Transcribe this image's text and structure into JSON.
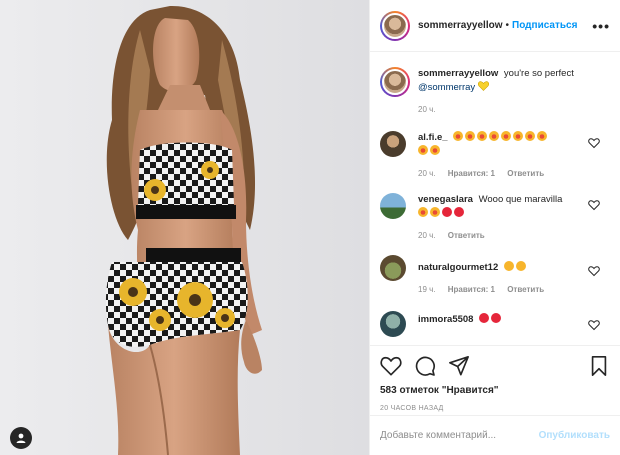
{
  "post": {
    "author": "sommerrayyellow",
    "separator": "•",
    "follow_label": "Подписаться",
    "more_label": "•••"
  },
  "caption": {
    "username": "sommerrayyellow",
    "text": "you're so perfect",
    "mention": "@sommerray",
    "emoji": "yellow-heart",
    "time": "20 ч."
  },
  "comments": [
    {
      "username": "al.fi.e_",
      "text": "",
      "emojis": 10,
      "time": "20 ч.",
      "likes": "Нравится: 1",
      "reply": "Ответить"
    },
    {
      "username": "venegaslara",
      "text": "Wooo que maravilla",
      "emojis": 4,
      "time": "20 ч.",
      "likes": "",
      "reply": "Ответить"
    },
    {
      "username": "naturalgourmet12",
      "text": "",
      "emojis": 2,
      "time": "19 ч.",
      "likes": "Нравится: 1",
      "reply": "Ответить"
    },
    {
      "username": "immora5508",
      "text": "",
      "emojis": 2,
      "time": "",
      "likes": "",
      "reply": ""
    }
  ],
  "footer": {
    "likes": "583 отметок \"Нравится\"",
    "date": "20 ЧАСОВ НАЗАД",
    "comment_placeholder": "Добавьте комментарий...",
    "publish_label": "Опубликовать"
  },
  "colors": {
    "link": "#0095f6",
    "publish_disabled": "#b2dffc",
    "muted": "#8e8e8e"
  },
  "icons": [
    "tag-people-icon",
    "heart-icon",
    "comment-icon",
    "share-icon",
    "bookmark-icon"
  ]
}
